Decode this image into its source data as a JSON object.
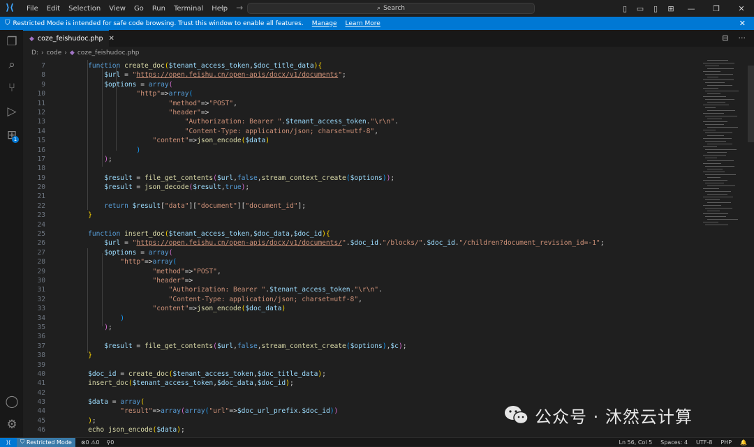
{
  "menu": [
    "File",
    "Edit",
    "Selection",
    "View",
    "Go",
    "Run",
    "Terminal",
    "Help"
  ],
  "search": {
    "label": "Search"
  },
  "banner": {
    "text": "Restricted Mode is intended for safe code browsing. Trust this window to enable all features.",
    "manage": "Manage",
    "learn": "Learn More"
  },
  "tab": {
    "filename": "coze_feishudoc.php"
  },
  "breadcrumb": {
    "drive": "D:",
    "folder": "code",
    "file": "coze_feishudoc.php"
  },
  "activity_badge": "1",
  "line_numbers": [
    "7",
    "8",
    "9",
    "10",
    "11",
    "12",
    "13",
    "14",
    "15",
    "16",
    "17",
    "18",
    "19",
    "20",
    "21",
    "22",
    "23",
    "24",
    "25",
    "26",
    "27",
    "28",
    "29",
    "30",
    "31",
    "32",
    "33",
    "34",
    "35",
    "36",
    "37",
    "38",
    "39",
    "40",
    "41",
    "42",
    "43",
    "44",
    "45",
    "46"
  ],
  "code_lines": [
    [
      [
        "kw",
        "    function "
      ],
      [
        "fn",
        "create_doc"
      ],
      [
        "bk1",
        "("
      ],
      [
        "var",
        "$tenant_access_token"
      ],
      [
        "pl",
        ","
      ],
      [
        "var",
        "$doc_title_data"
      ],
      [
        "bk1",
        ")"
      ],
      [
        "bk1",
        "{"
      ]
    ],
    [
      [
        "var",
        "        $url"
      ],
      [
        "pl",
        " = "
      ],
      [
        "str",
        "\""
      ],
      [
        "url",
        "https://open.feishu.cn/open-apis/docx/v1/documents"
      ],
      [
        "str",
        "\""
      ],
      [
        "pl",
        ";"
      ]
    ],
    [
      [
        "var",
        "        $options"
      ],
      [
        "pl",
        " = "
      ],
      [
        "kw",
        "array"
      ],
      [
        "bk2",
        "("
      ]
    ],
    [
      [
        "str",
        "                \"http\""
      ],
      [
        "pl",
        "=>"
      ],
      [
        "kw",
        "array"
      ],
      [
        "bk3",
        "("
      ]
    ],
    [
      [
        "str",
        "                        \"method\""
      ],
      [
        "pl",
        "=>"
      ],
      [
        "str",
        "\"POST\""
      ],
      [
        "pl",
        ","
      ]
    ],
    [
      [
        "str",
        "                        \"header\""
      ],
      [
        "pl",
        "=>"
      ]
    ],
    [
      [
        "str",
        "                            \"Authorization: Bearer \""
      ],
      [
        "pl",
        "."
      ],
      [
        "var",
        "$tenant_access_token"
      ],
      [
        "pl",
        "."
      ],
      [
        "str",
        "\"\\r\\n\""
      ],
      [
        "pl",
        "."
      ]
    ],
    [
      [
        "str",
        "                            \"Content-Type: application/json; charset=utf-8\""
      ],
      [
        "pl",
        ","
      ]
    ],
    [
      [
        "str",
        "                    \"content\""
      ],
      [
        "pl",
        "=>"
      ],
      [
        "fn",
        "json_encode"
      ],
      [
        "bk1",
        "("
      ],
      [
        "var",
        "$data"
      ],
      [
        "bk1",
        ")"
      ]
    ],
    [
      [
        "bk3",
        "                )"
      ]
    ],
    [
      [
        "bk2",
        "        )"
      ],
      [
        "pl",
        ";"
      ]
    ],
    [
      [
        "pl",
        ""
      ]
    ],
    [
      [
        "var",
        "        $result"
      ],
      [
        "pl",
        " = "
      ],
      [
        "fn",
        "file_get_contents"
      ],
      [
        "bk2",
        "("
      ],
      [
        "var",
        "$url"
      ],
      [
        "pl",
        ","
      ],
      [
        "kw",
        "false"
      ],
      [
        "pl",
        ","
      ],
      [
        "fn",
        "stream_context_create"
      ],
      [
        "bk3",
        "("
      ],
      [
        "var",
        "$options"
      ],
      [
        "bk3",
        ")"
      ],
      [
        "bk2",
        ")"
      ],
      [
        "pl",
        ";"
      ]
    ],
    [
      [
        "var",
        "        $result"
      ],
      [
        "pl",
        " = "
      ],
      [
        "fn",
        "json_decode"
      ],
      [
        "bk2",
        "("
      ],
      [
        "var",
        "$result"
      ],
      [
        "pl",
        ","
      ],
      [
        "kw",
        "true"
      ],
      [
        "bk2",
        ")"
      ],
      [
        "pl",
        ";"
      ]
    ],
    [
      [
        "pl",
        ""
      ]
    ],
    [
      [
        "kw",
        "        return "
      ],
      [
        "var",
        "$result"
      ],
      [
        "pl",
        "["
      ],
      [
        "str",
        "\"data\""
      ],
      [
        "pl",
        "]["
      ],
      [
        "str",
        "\"document\""
      ],
      [
        "pl",
        "]["
      ],
      [
        "str",
        "\"document_id\""
      ],
      [
        "pl",
        "];"
      ]
    ],
    [
      [
        "bk1",
        "    }"
      ]
    ],
    [
      [
        "pl",
        ""
      ]
    ],
    [
      [
        "kw",
        "    function "
      ],
      [
        "fn",
        "insert_doc"
      ],
      [
        "bk1",
        "("
      ],
      [
        "var",
        "$tenant_access_token"
      ],
      [
        "pl",
        ","
      ],
      [
        "var",
        "$doc_data"
      ],
      [
        "pl",
        ","
      ],
      [
        "var",
        "$doc_id"
      ],
      [
        "bk1",
        ")"
      ],
      [
        "bk1",
        "{"
      ]
    ],
    [
      [
        "var",
        "        $url"
      ],
      [
        "pl",
        " = "
      ],
      [
        "str",
        "\""
      ],
      [
        "url",
        "https://open.feishu.cn/open-apis/docx/v1/documents/"
      ],
      [
        "str",
        "\""
      ],
      [
        "pl",
        "."
      ],
      [
        "var",
        "$doc_id"
      ],
      [
        "pl",
        "."
      ],
      [
        "str",
        "\"/blocks/\""
      ],
      [
        "pl",
        "."
      ],
      [
        "var",
        "$doc_id"
      ],
      [
        "pl",
        "."
      ],
      [
        "str",
        "\"/children?document_revision_id=-1\""
      ],
      [
        "pl",
        ";"
      ]
    ],
    [
      [
        "var",
        "        $options"
      ],
      [
        "pl",
        " = "
      ],
      [
        "kw",
        "array"
      ],
      [
        "bk2",
        "("
      ]
    ],
    [
      [
        "str",
        "            \"http\""
      ],
      [
        "pl",
        "=>"
      ],
      [
        "kw",
        "array"
      ],
      [
        "bk3",
        "("
      ]
    ],
    [
      [
        "str",
        "                    \"method\""
      ],
      [
        "pl",
        "=>"
      ],
      [
        "str",
        "\"POST\""
      ],
      [
        "pl",
        ","
      ]
    ],
    [
      [
        "str",
        "                    \"header\""
      ],
      [
        "pl",
        "=>"
      ]
    ],
    [
      [
        "str",
        "                        \"Authorization: Bearer \""
      ],
      [
        "pl",
        "."
      ],
      [
        "var",
        "$tenant_access_token"
      ],
      [
        "pl",
        "."
      ],
      [
        "str",
        "\"\\r\\n\""
      ],
      [
        "pl",
        "."
      ]
    ],
    [
      [
        "str",
        "                        \"Content-Type: application/json; charset=utf-8\""
      ],
      [
        "pl",
        ","
      ]
    ],
    [
      [
        "str",
        "                    \"content\""
      ],
      [
        "pl",
        "=>"
      ],
      [
        "fn",
        "json_encode"
      ],
      [
        "bk1",
        "("
      ],
      [
        "var",
        "$doc_data"
      ],
      [
        "bk1",
        ")"
      ]
    ],
    [
      [
        "bk3",
        "            )"
      ]
    ],
    [
      [
        "bk2",
        "        )"
      ],
      [
        "pl",
        ";"
      ]
    ],
    [
      [
        "pl",
        ""
      ]
    ],
    [
      [
        "var",
        "        $result"
      ],
      [
        "pl",
        " = "
      ],
      [
        "fn",
        "file_get_contents"
      ],
      [
        "bk2",
        "("
      ],
      [
        "var",
        "$url"
      ],
      [
        "pl",
        ","
      ],
      [
        "kw",
        "false"
      ],
      [
        "pl",
        ","
      ],
      [
        "fn",
        "stream_context_create"
      ],
      [
        "bk3",
        "("
      ],
      [
        "var",
        "$options"
      ],
      [
        "bk3",
        ")"
      ],
      [
        "pl",
        ","
      ],
      [
        "var",
        "$c"
      ],
      [
        "bk2",
        ")"
      ],
      [
        "pl",
        ";"
      ]
    ],
    [
      [
        "bk1",
        "    }"
      ]
    ],
    [
      [
        "pl",
        ""
      ]
    ],
    [
      [
        "var",
        "    $doc_id"
      ],
      [
        "pl",
        " = "
      ],
      [
        "fn",
        "create_doc"
      ],
      [
        "bk1",
        "("
      ],
      [
        "var",
        "$tenant_access_token"
      ],
      [
        "pl",
        ","
      ],
      [
        "var",
        "$doc_title_data"
      ],
      [
        "bk1",
        ")"
      ],
      [
        "pl",
        ";"
      ]
    ],
    [
      [
        "fn",
        "    insert_doc"
      ],
      [
        "bk1",
        "("
      ],
      [
        "var",
        "$tenant_access_token"
      ],
      [
        "pl",
        ","
      ],
      [
        "var",
        "$doc_data"
      ],
      [
        "pl",
        ","
      ],
      [
        "var",
        "$doc_id"
      ],
      [
        "bk1",
        ")"
      ],
      [
        "pl",
        ";"
      ]
    ],
    [
      [
        "pl",
        ""
      ]
    ],
    [
      [
        "var",
        "    $data"
      ],
      [
        "pl",
        " = "
      ],
      [
        "kw",
        "array"
      ],
      [
        "bk1",
        "("
      ]
    ],
    [
      [
        "str",
        "            \"result\""
      ],
      [
        "pl",
        "=>"
      ],
      [
        "kw",
        "array"
      ],
      [
        "bk2",
        "("
      ],
      [
        "kw",
        "array"
      ],
      [
        "bk3",
        "("
      ],
      [
        "str",
        "\"url\""
      ],
      [
        "pl",
        "=>"
      ],
      [
        "var",
        "$doc_url_prefix"
      ],
      [
        "pl",
        "."
      ],
      [
        "var",
        "$doc_id"
      ],
      [
        "bk3",
        ")"
      ],
      [
        "bk2",
        ")"
      ]
    ],
    [
      [
        "bk1",
        "    )"
      ],
      [
        "pl",
        ";"
      ]
    ],
    [
      [
        "fn",
        "    echo "
      ],
      [
        "fn",
        "json_encode"
      ],
      [
        "bk1",
        "("
      ],
      [
        "var",
        "$data"
      ],
      [
        "bk1",
        ")"
      ],
      [
        "pl",
        ";"
      ]
    ]
  ],
  "watermark": "公众号 · 沐然云计算",
  "status": {
    "restricted": "Restricted Mode",
    "errors": "0",
    "warnings": "0",
    "ports": "0",
    "position": "Ln 56, Col 5",
    "spaces": "Spaces: 4",
    "encoding": "UTF-8",
    "language": "PHP"
  },
  "colors": {
    "accent": "#0078d4",
    "keyword": "#569cd6",
    "function": "#dcdcaa",
    "variable": "#9cdcfe",
    "string": "#ce9178"
  }
}
